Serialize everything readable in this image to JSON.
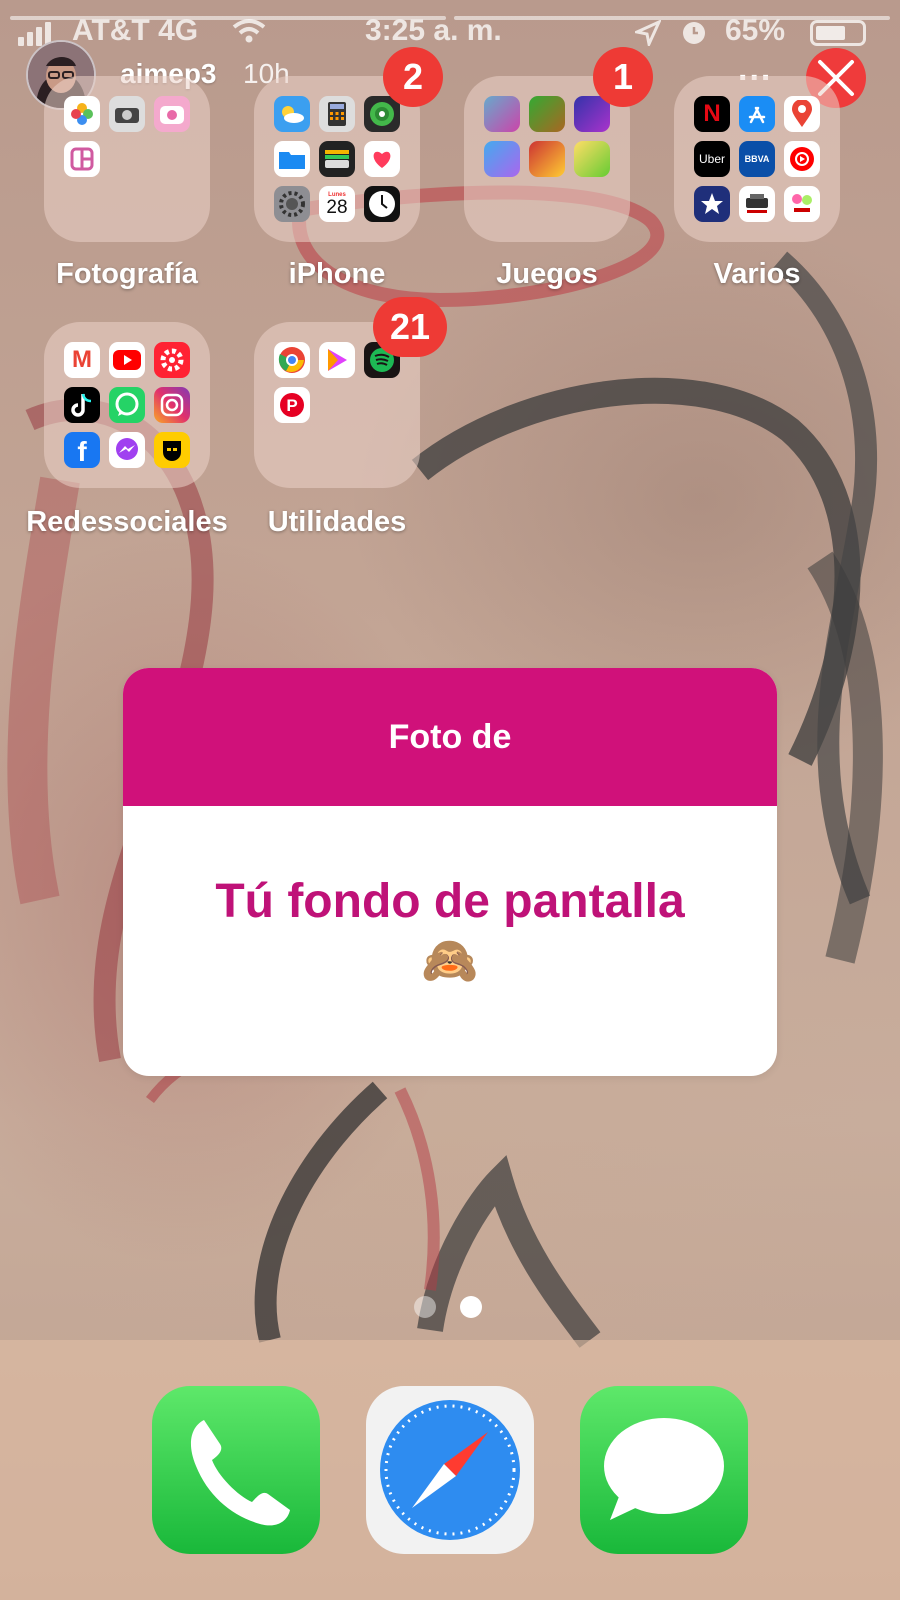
{
  "status_bar": {
    "carrier": "AT&T 4G",
    "time": "3:25 a. m.",
    "battery": "65%",
    "battery_level": 0.65
  },
  "story": {
    "username": "aimep3",
    "age": "10h",
    "more": "...",
    "progress_segments": 2
  },
  "folders": [
    {
      "label": "Fotografía",
      "badge": "",
      "apps": [
        "photos-icon",
        "camera-icon",
        "beauty-camera-icon",
        "layout-icon"
      ]
    },
    {
      "label": "iPhone",
      "badge": "2",
      "apps": [
        "weather-icon",
        "calculator-icon",
        "find-my-icon",
        "files-icon",
        "wallet-icon",
        "health-icon",
        "settings-icon",
        "calendar-icon",
        "clock-icon"
      ],
      "calendar_day": "Lunes",
      "calendar_date": "28"
    },
    {
      "label": "Juegos",
      "badge": "1",
      "apps": [
        "game-icon",
        "game-icon",
        "game-icon",
        "game-icon",
        "game-icon",
        "game-icon"
      ]
    },
    {
      "label": "Varios",
      "badge": "",
      "apps": [
        "netflix-icon",
        "app-store-icon",
        "google-maps-icon",
        "uber-icon",
        "bbva-icon",
        "youtube-music-icon",
        "star-icon",
        "canon-printer-icon",
        "canon-icon"
      ],
      "mini_text": {
        "netflix": "N",
        "uber": "Uber",
        "bbva": "BBVA"
      }
    },
    {
      "label": "Redessociales",
      "badge": "",
      "apps": [
        "gmail-icon",
        "youtube-icon",
        "settings-flower-icon",
        "tiktok-icon",
        "whatsapp-icon",
        "instagram-icon",
        "facebook-icon",
        "messenger-icon",
        "grindr-icon"
      ],
      "mini_text": {
        "gmail": "M",
        "facebook": "f"
      }
    },
    {
      "label": "Utilidades",
      "badge": "21",
      "apps": [
        "chrome-icon",
        "play-icon",
        "spotify-icon",
        "pinterest-icon"
      ],
      "mini_text": {
        "pinterest": "P"
      }
    }
  ],
  "sticker": {
    "header": "Foto de",
    "text": "Tú fondo de pantalla",
    "emoji": "🙈"
  },
  "page_dots": {
    "count": 2,
    "active": 2
  },
  "dock": [
    "phone-icon",
    "safari-icon",
    "messages-icon"
  ],
  "colors": {
    "accent": "#d0117a",
    "badge": "#ee3a35",
    "text_pink": "#bf1278"
  }
}
